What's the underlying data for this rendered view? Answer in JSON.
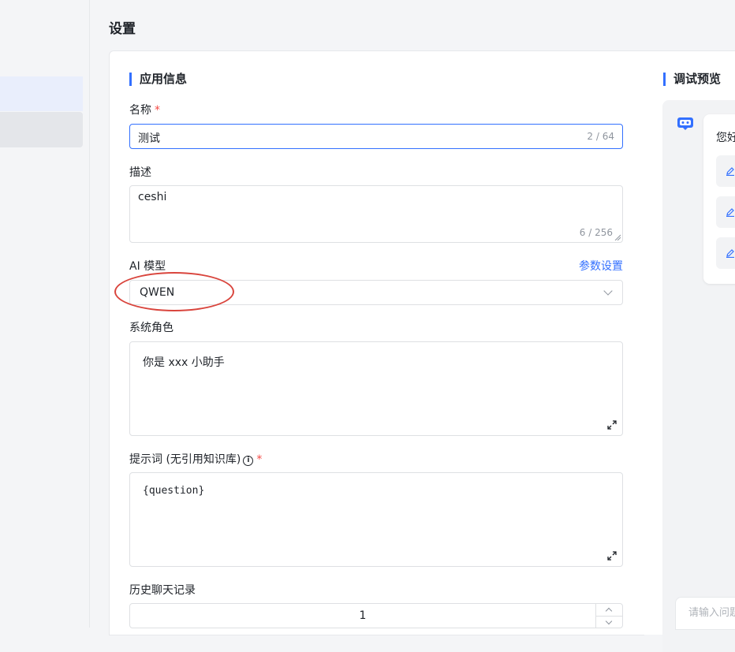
{
  "page": {
    "title": "设置"
  },
  "app_info": {
    "section_title": "应用信息",
    "name": {
      "label": "名称",
      "required_mark": "*",
      "value": "测试",
      "count": "2 / 64"
    },
    "description": {
      "label": "描述",
      "value": "ceshi",
      "count": "6 / 256"
    },
    "model": {
      "label": "AI 模型",
      "param_link": "参数设置",
      "selected": "QWEN"
    },
    "system_role": {
      "label": "系统角色",
      "value": "你是 xxx 小助手"
    },
    "prompt": {
      "label": "提示词 (无引用知识库)",
      "info_glyph": "i",
      "required_mark": "*",
      "value": "{question}"
    },
    "history": {
      "label": "历史聊天记录",
      "value": "1"
    }
  },
  "preview": {
    "title": "调试预览",
    "greeting": "您好",
    "input_placeholder": "请输入问题"
  },
  "colors": {
    "accent": "#3370ff",
    "required": "#f54a45",
    "annotation": "#d9453d"
  }
}
